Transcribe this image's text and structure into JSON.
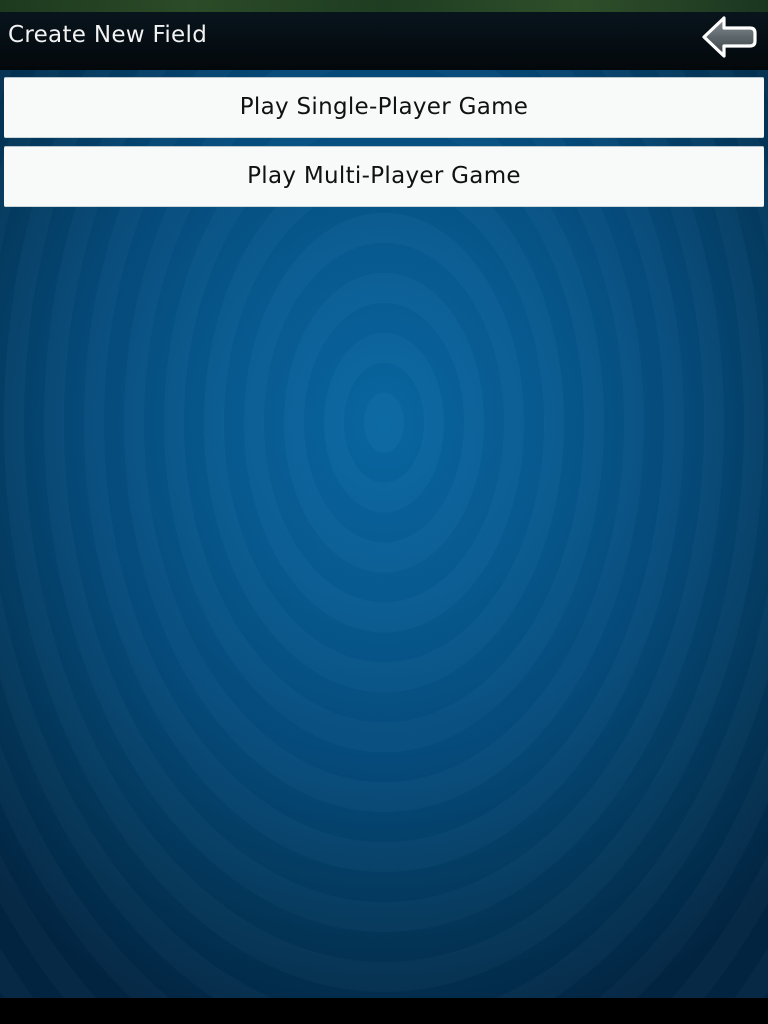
{
  "header": {
    "title": "Create New Field",
    "back_icon": "back-arrow-icon"
  },
  "menu": {
    "single_player_label": "Play Single-Player Game",
    "multi_player_label": "Play Multi-Player Game"
  },
  "colors": {
    "header_bg": "#050d12",
    "content_center": "#0967a2",
    "content_edge": "#022542",
    "button_bg": "#f7faf8",
    "top_strip": "#2c4b27"
  }
}
